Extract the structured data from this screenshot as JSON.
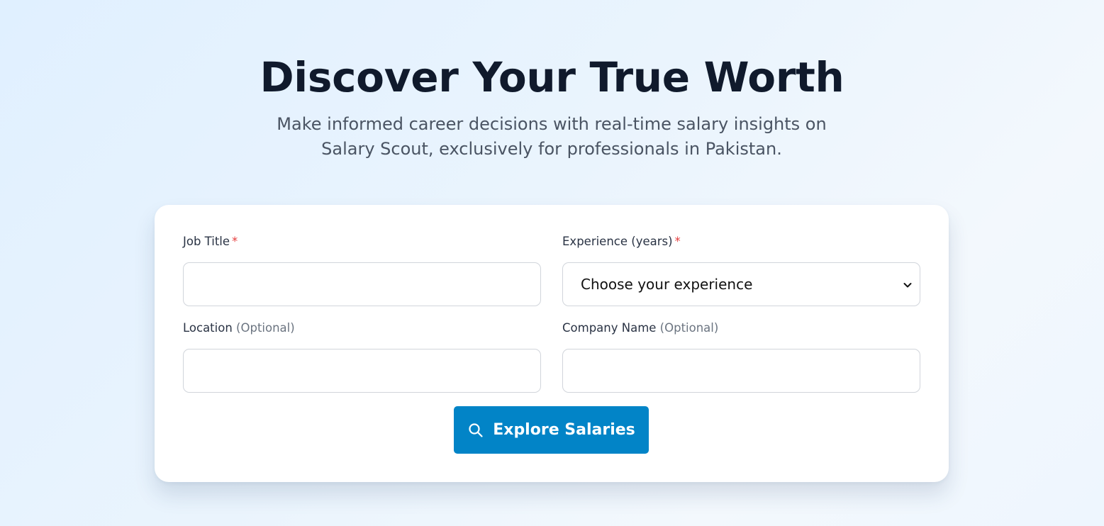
{
  "hero": {
    "title": "Discover Your True Worth",
    "subtitle_line1": "Make informed career decisions with real-time salary insights on",
    "subtitle_line2": "Salary Scout, exclusively for professionals in Pakistan."
  },
  "form": {
    "job_title": {
      "label": "Job Title",
      "required_mark": "*",
      "value": ""
    },
    "experience": {
      "label": "Experience (years)",
      "required_mark": "*",
      "selected": "Choose your experience"
    },
    "location": {
      "label": "Location",
      "optional_text": "(Optional)",
      "value": ""
    },
    "company": {
      "label": "Company Name",
      "optional_text": "(Optional)",
      "value": ""
    },
    "submit": {
      "label": "Explore Salaries",
      "icon": "search-icon"
    }
  },
  "colors": {
    "accent": "#0284c7",
    "required": "#e53e3e",
    "title": "#101a2c"
  }
}
